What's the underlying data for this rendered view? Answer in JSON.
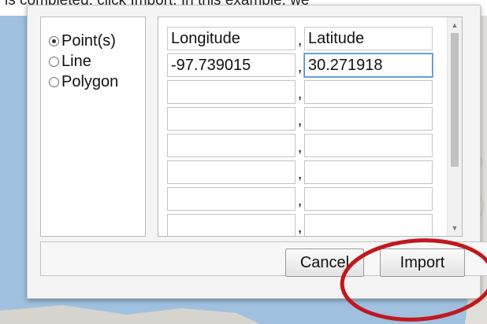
{
  "top_text": "is completed, click Import. In this example, we",
  "dialog": {
    "geometry_types": [
      {
        "label": "Point(s)",
        "checked": true
      },
      {
        "label": "Line",
        "checked": false
      },
      {
        "label": "Polygon",
        "checked": false
      }
    ],
    "columns": {
      "longitude": "Longitude",
      "latitude": "Latitude",
      "separator": ","
    },
    "rows": [
      {
        "longitude": "-97.739015",
        "latitude": "30.271918"
      },
      {
        "longitude": "",
        "latitude": ""
      },
      {
        "longitude": "",
        "latitude": ""
      },
      {
        "longitude": "",
        "latitude": ""
      },
      {
        "longitude": "",
        "latitude": ""
      },
      {
        "longitude": "",
        "latitude": ""
      },
      {
        "longitude": "",
        "latitude": ""
      }
    ],
    "cancel_label": "Cancel",
    "import_label": "Import"
  },
  "colors": {
    "map_water": "#9fc1df",
    "annotation_circle": "#c0181f",
    "focus_border": "#4f8fd3"
  }
}
